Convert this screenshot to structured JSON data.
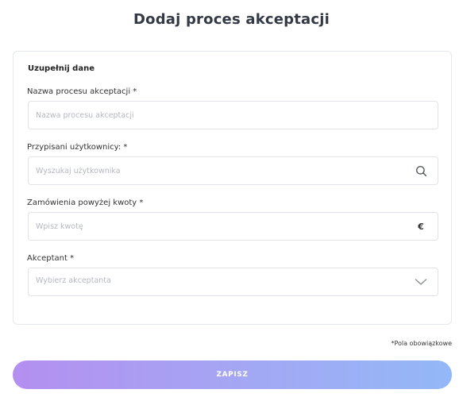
{
  "page": {
    "title": "Dodaj proces akceptacji"
  },
  "form": {
    "section_heading": "Uzupełnij dane",
    "fields": [
      {
        "label": "Nazwa procesu akceptacji *",
        "placeholder": "Nazwa procesu akceptacji",
        "value": ""
      },
      {
        "label": "Przypisani użytkownicy: *",
        "placeholder": "Wyszukaj użytkownika",
        "value": "",
        "icon": "search-icon"
      },
      {
        "label": "Zamówienia powyżej kwoty *",
        "placeholder": "Wpisz kwotę",
        "value": "",
        "suffix": "€"
      },
      {
        "label": "Akceptant *",
        "placeholder": "Wybierz akceptanta",
        "value": "",
        "icon": "chevron-down-icon"
      }
    ]
  },
  "required_note": "*Pola obowiązkowe",
  "save_label": "ZAPISZ",
  "colors": {
    "button_gradient_start": "#b48ff0",
    "button_gradient_end": "#93b8f7",
    "border": "#e0e3e8"
  }
}
